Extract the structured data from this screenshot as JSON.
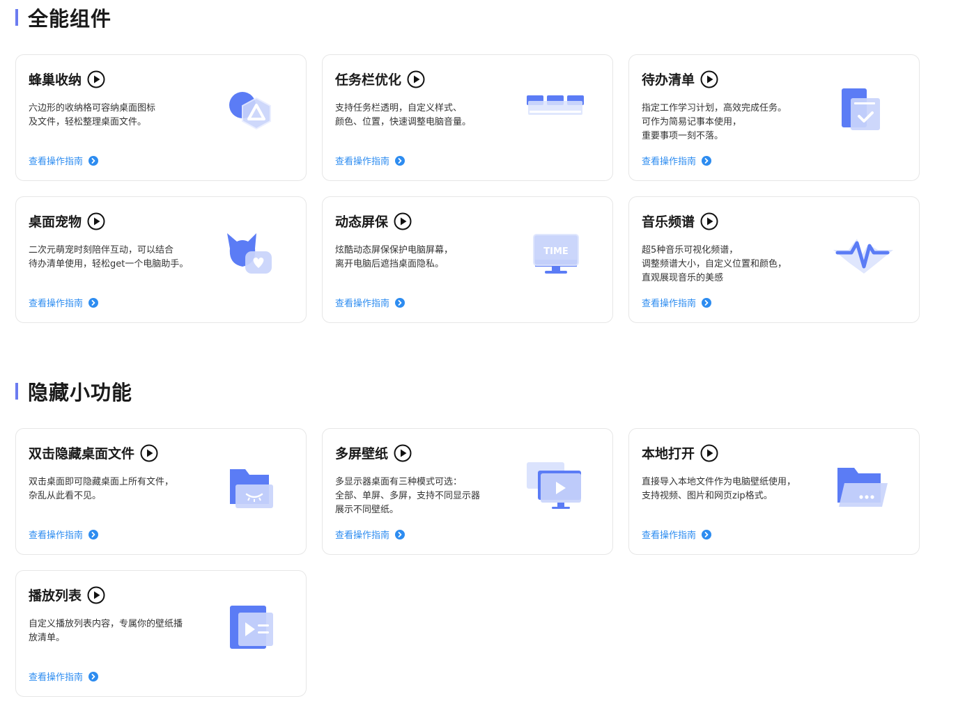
{
  "sections": [
    {
      "title": "全能组件",
      "cards": [
        {
          "key": "honeycomb",
          "icon": "honeycomb-icon",
          "title": "蜂巢收纳",
          "desc": [
            "六边形的收纳格可容纳桌面图标",
            "及文件，轻松整理桌面文件。"
          ],
          "link": "查看操作指南"
        },
        {
          "key": "taskbar",
          "icon": "taskbar-icon",
          "title": "任务栏优化",
          "desc": [
            "支持任务栏透明，自定义样式、",
            "颜色、位置，快速调整电脑音量。"
          ],
          "link": "查看操作指南"
        },
        {
          "key": "todo",
          "icon": "todo-list-icon",
          "title": "待办清单",
          "desc": [
            "指定工作学习计划，高效完成任务。",
            "可作为简易记事本使用，",
            "重要事项一刻不落。"
          ],
          "link": "查看操作指南"
        },
        {
          "key": "pet",
          "icon": "desktop-pet-icon",
          "title": "桌面宠物",
          "desc": [
            "二次元萌宠时刻陪伴互动，可以结合",
            "待办清单使用，轻松get一个电脑助手。"
          ],
          "link": "查看操作指南"
        },
        {
          "key": "screensaver",
          "icon": "screensaver-monitor-icon",
          "title": "动态屏保",
          "desc": [
            "炫酷动态屏保保护电脑屏幕，",
            "离开电脑后遮挡桌面隐私。"
          ],
          "link": "查看操作指南",
          "badge": "TIME"
        },
        {
          "key": "music",
          "icon": "music-spectrum-icon",
          "title": "音乐频谱",
          "desc": [
            "超5种音乐可视化频谱，",
            "调整频谱大小，自定义位置和颜色，",
            "直观展现音乐的美感"
          ],
          "link": "查看操作指南"
        }
      ]
    },
    {
      "title": "隐藏小功能",
      "cards": [
        {
          "key": "hidefiles",
          "icon": "hidden-folder-icon",
          "title": "双击隐藏桌面文件",
          "desc": [
            "双击桌面即可隐藏桌面上所有文件，",
            "杂乱从此看不见。"
          ],
          "link": "查看操作指南"
        },
        {
          "key": "multiscreen",
          "icon": "multi-monitor-icon",
          "title": "多屏壁纸",
          "desc": [
            "多显示器桌面有三种模式可选：",
            "全部、单屏、多屏，支持不同显示器",
            "展示不同壁纸。"
          ],
          "link": "查看操作指南"
        },
        {
          "key": "localopen",
          "icon": "local-folder-icon",
          "title": "本地打开",
          "desc": [
            "直接导入本地文件作为电脑壁纸使用，",
            "支持视频、图片和网页zip格式。"
          ],
          "link": "查看操作指南"
        },
        {
          "key": "playlist",
          "icon": "playlist-icon",
          "title": "播放列表",
          "desc": [
            "自定义播放列表内容，专属你的壁纸播",
            "放清单。"
          ],
          "link": "查看操作指南"
        }
      ]
    }
  ],
  "colors": {
    "accent": "#6b7cf0",
    "link": "#2d8cf0",
    "border": "#e6e6e6"
  }
}
